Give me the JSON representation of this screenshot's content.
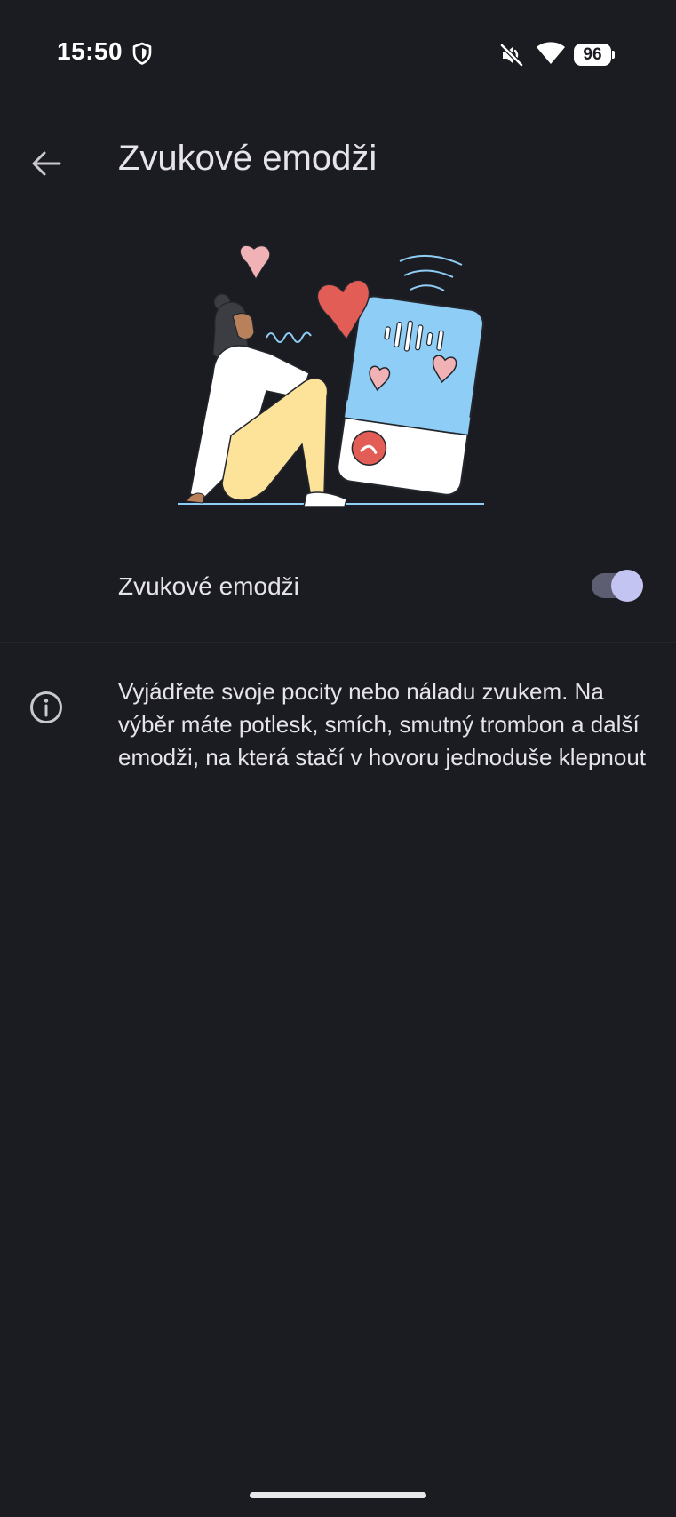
{
  "status_bar": {
    "time": "15:50",
    "battery_level": "96",
    "icons": [
      "shield-icon",
      "mute-icon",
      "wifi-icon",
      "battery-icon"
    ]
  },
  "header": {
    "back_icon": "arrow-back-icon",
    "title": "Zvukové emodži"
  },
  "illustration": {
    "icon": "sound-emoji-illustration"
  },
  "toggle": {
    "label": "Zvukové emodži",
    "state": "on"
  },
  "info": {
    "icon": "info-icon",
    "text": "Vyjádřete svoje pocity nebo náladu zvukem. Na výběr máte potlesk, smích, smutný trombon a další emodži, na která stačí v hovoru jednoduše klepnout"
  },
  "colors": {
    "background": "#1b1c21",
    "text": "#e6e4ea",
    "switch_track": "#5d5e72",
    "switch_thumb": "#c3c4f1",
    "heart_red": "#e35d57",
    "heart_pink": "#f1b2b5",
    "phone_blue": "#8ecdf5",
    "pants_yellow": "#fde29a"
  }
}
